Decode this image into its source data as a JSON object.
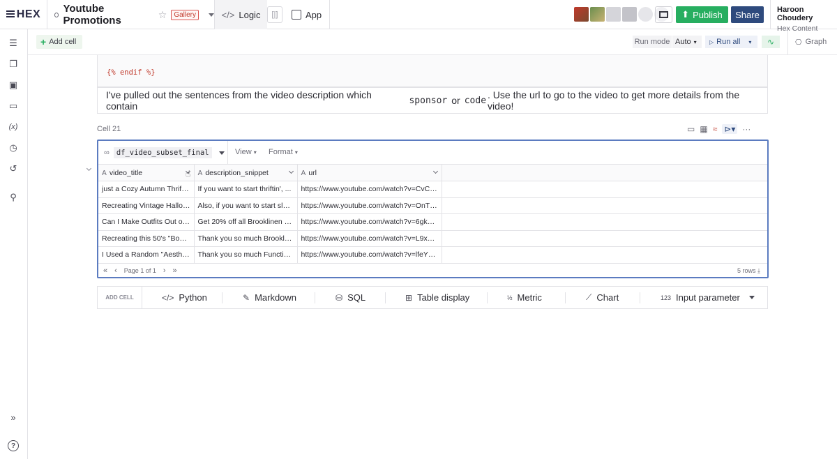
{
  "topbar": {
    "logo": "HEX",
    "project_title": "Youtube Promotions",
    "badge": "Gallery",
    "logic_label": "Logic",
    "app_label": "App",
    "publish_label": "Publish",
    "share_label": "Share",
    "user_name": "Haroon Choudery",
    "user_org": "Hex Content"
  },
  "toolbar": {
    "add_cell_label": "Add cell",
    "run_mode_label": "Run mode",
    "run_mode_value": "Auto",
    "run_all_label": "Run all",
    "graph_label": "Graph"
  },
  "code_cell": {
    "code": "{% endif %}"
  },
  "markdown_cell": {
    "part1": "I've pulled out the sentences from the video description which contain",
    "code1": "sponsor",
    "part2": "or",
    "code2": "code",
    "part3": ". Use the url to go to the video to get more details from the video!"
  },
  "table_cell": {
    "label": "Cell 21",
    "dataframe": "df_video_subset_final",
    "view_label": "View",
    "format_label": "Format",
    "columns": [
      "video_title",
      "description_snippet",
      "url"
    ],
    "rows": [
      [
        "just a Cozy Autumn Thrift ...",
        "If you want to start thriftin', ...",
        "https://www.youtube.com/watch?v=CvCe..."
      ],
      [
        "Recreating Vintage Hallow...",
        "Also, if you want to start sleu...",
        "https://www.youtube.com/watch?v=OnTvj..."
      ],
      [
        "Can I Make Outfits Out of ...",
        "Get 20% off all Brooklinen pr...",
        "https://www.youtube.com/watch?v=6gkW..."
      ],
      [
        "Recreating this 50's \"Book...",
        "Thank you so much Brooklin...",
        "https://www.youtube.com/watch?v=L9xm..."
      ],
      [
        "I Used a Random \"Aesthet...",
        "Thank you so much Function...",
        "https://www.youtube.com/watch?v=lfeYM..."
      ]
    ],
    "page_text": "Page 1 of 1",
    "rows_count": "5 rows"
  },
  "add_cell_bar": {
    "label": "ADD CELL",
    "python": "Python",
    "markdown": "Markdown",
    "sql": "SQL",
    "table_display": "Table display",
    "metric": "Metric",
    "chart": "Chart",
    "input_parameter_prefix": "123",
    "input_parameter": "Input parameter"
  },
  "colors": {
    "accent": "#5b7bc0",
    "publish": "#27ae60",
    "share": "#2e4a7d",
    "badge": "#c0392b"
  }
}
